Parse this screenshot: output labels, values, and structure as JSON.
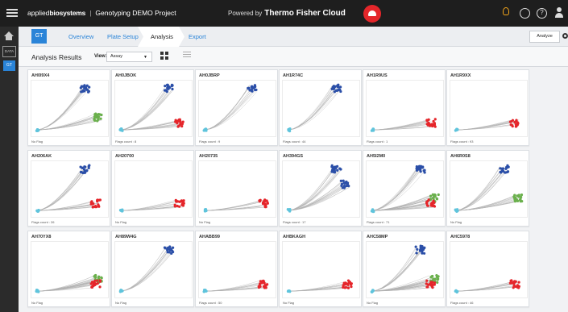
{
  "header": {
    "brand_light": "applied",
    "brand_bold": "biosystems",
    "separator": "|",
    "app": "Genotyping DEMO Project",
    "powered_by": "Powered by",
    "powered_name": "Thermo Fisher Cloud",
    "help_icon_label": "?"
  },
  "sidebar": {
    "data_label": "DATA",
    "gt_label": "GT"
  },
  "nav": {
    "badge": "GT",
    "tabs": [
      {
        "label": "Overview"
      },
      {
        "label": "Plate Setup"
      },
      {
        "label": "Analysis"
      },
      {
        "label": "Export"
      }
    ],
    "analyze_button": "Analyze"
  },
  "toolbar": {
    "title": "Analysis Results",
    "view_label": "View:",
    "view_value": "Assay"
  },
  "colors": {
    "blue": "#2b4fa8",
    "red": "#e5252a",
    "green": "#6ab04c",
    "cyan": "#5fc4dc",
    "gray": "#b0b0b0",
    "accent": "#2a84d8"
  },
  "cards": [
    {
      "id": "AH0I9X4",
      "flag": "No Flag",
      "clusters": [
        "blue",
        "green"
      ]
    },
    {
      "id": "AH0JBOK",
      "flag": "Flags count : 8",
      "clusters": [
        "blue",
        "red"
      ]
    },
    {
      "id": "AH0JBRP",
      "flag": "Flags count : 9",
      "clusters": [
        "blue"
      ]
    },
    {
      "id": "AH1R74C",
      "flag": "Flags count : 44",
      "clusters": [
        "blue"
      ]
    },
    {
      "id": "AH1R9US",
      "flag": "Flags count : 1",
      "clusters": [
        "red"
      ]
    },
    {
      "id": "AH1R9XX",
      "flag": "Flags count : 93",
      "clusters": [
        "red"
      ]
    },
    {
      "id": "AH206AK",
      "flag": "Flags count : 26",
      "clusters": [
        "blue",
        "red"
      ]
    },
    {
      "id": "AH20700",
      "flag": "No Flag",
      "clusters": [
        "red"
      ]
    },
    {
      "id": "AH20735",
      "flag": "No Flag",
      "clusters": [
        "red"
      ]
    },
    {
      "id": "AH394GS",
      "flag": "Flags count : 17",
      "clusters": [
        "blue",
        "blue-low"
      ]
    },
    {
      "id": "AH5I2M0",
      "flag": "Flags count : 71",
      "clusters": [
        "blue",
        "green",
        "red"
      ]
    },
    {
      "id": "AH6R0S8",
      "flag": "No Flag",
      "clusters": [
        "blue",
        "green"
      ]
    },
    {
      "id": "AH70YX8",
      "flag": "No Flag",
      "clusters": [
        "green",
        "red"
      ]
    },
    {
      "id": "AH89W4G",
      "flag": "No Flag",
      "clusters": [
        "blue"
      ]
    },
    {
      "id": "AHABB99",
      "flag": "Flags count : 50",
      "clusters": [
        "red"
      ]
    },
    {
      "id": "AHBKAGH",
      "flag": "No Flag",
      "clusters": [
        "red"
      ]
    },
    {
      "id": "AHC58MP",
      "flag": "No Flag",
      "clusters": [
        "blue",
        "green",
        "red"
      ]
    },
    {
      "id": "AHC5978",
      "flag": "Flags count : 46",
      "clusters": [
        "red"
      ]
    }
  ]
}
